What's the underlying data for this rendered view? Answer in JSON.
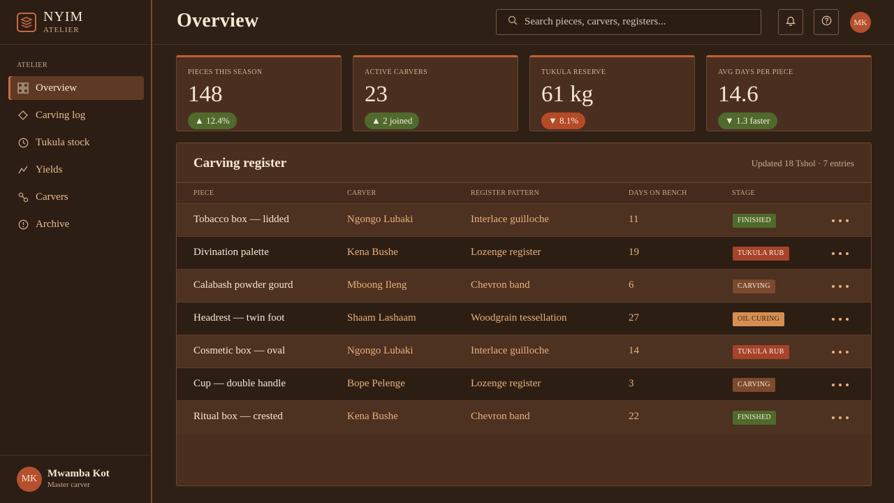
{
  "brand": {
    "name": "NYIM",
    "sub": "ATELIER"
  },
  "sidebar": {
    "section": "ATELIER",
    "items": [
      {
        "label": "Overview",
        "icon": "grid-icon",
        "active": true
      },
      {
        "label": "Carving log",
        "icon": "diamond-icon"
      },
      {
        "label": "Tukula stock",
        "icon": "clock-icon"
      },
      {
        "label": "Yields",
        "icon": "trend-icon"
      },
      {
        "label": "Carvers",
        "icon": "carvers-icon"
      },
      {
        "label": "Archive",
        "icon": "archive-icon"
      }
    ]
  },
  "user": {
    "initials": "MK",
    "name": "Mwamba Kot",
    "role": "Master carver"
  },
  "header": {
    "title": "Overview",
    "search_placeholder": "Search pieces, carvers, registers...",
    "avatar_initials": "MK"
  },
  "stats": [
    {
      "label": "PIECES THIS SEASON",
      "value": "148",
      "badge": "▲ 12.4%",
      "trend": "up"
    },
    {
      "label": "ACTIVE CARVERS",
      "value": "23",
      "badge": "▲ 2 joined",
      "trend": "up"
    },
    {
      "label": "TUKULA RESERVE",
      "value": "61 kg",
      "badge": "▼ 8.1%",
      "trend": "down"
    },
    {
      "label": "AVG DAYS PER PIECE",
      "value": "14.6",
      "badge": "▼ 1.3 faster",
      "trend": "up"
    }
  ],
  "register": {
    "title": "Carving register",
    "meta": "Updated 18 Tshol · 7 entries",
    "columns": [
      "PIECE",
      "CARVER",
      "REGISTER PATTERN",
      "DAYS ON BENCH",
      "STAGE"
    ],
    "rows": [
      {
        "piece": "Tobacco box — lidded",
        "carver": "Ngongo Lubaki",
        "pattern": "Interlace guilloche",
        "days": "11",
        "stage": "FINISHED",
        "stage_kind": "finished"
      },
      {
        "piece": "Divination palette",
        "carver": "Kena Bushe",
        "pattern": "Lozenge register",
        "days": "19",
        "stage": "TUKULA RUB",
        "stage_kind": "rub"
      },
      {
        "piece": "Calabash powder gourd",
        "carver": "Mboong Ileng",
        "pattern": "Chevron band",
        "days": "6",
        "stage": "CARVING",
        "stage_kind": "carving"
      },
      {
        "piece": "Headrest — twin foot",
        "carver": "Shaam Lashaam",
        "pattern": "Woodgrain tessellation",
        "days": "27",
        "stage": "OIL CURING",
        "stage_kind": "oil"
      },
      {
        "piece": "Cosmetic box — oval",
        "carver": "Ngongo Lubaki",
        "pattern": "Interlace guilloche",
        "days": "14",
        "stage": "TUKULA RUB",
        "stage_kind": "rub"
      },
      {
        "piece": "Cup — double handle",
        "carver": "Bope Pelenge",
        "pattern": "Lozenge register",
        "days": "3",
        "stage": "CARVING",
        "stage_kind": "carving"
      },
      {
        "piece": "Ritual box — crested",
        "carver": "Kena Bushe",
        "pattern": "Chevron band",
        "days": "22",
        "stage": "FINISHED",
        "stage_kind": "finished"
      }
    ]
  },
  "colors": {
    "accent": "#c9693f",
    "up": "#506a2e",
    "down": "#b54a28"
  }
}
